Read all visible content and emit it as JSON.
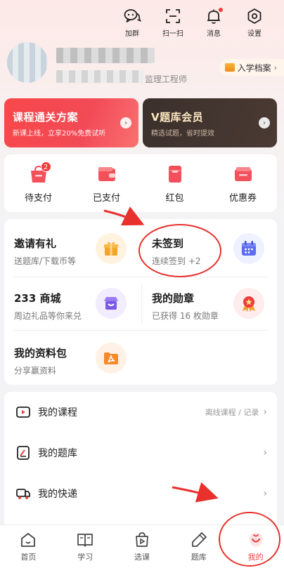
{
  "top_actions": [
    {
      "label": "加群",
      "icon": "wechat-group-icon"
    },
    {
      "label": "扫一扫",
      "icon": "scan-icon"
    },
    {
      "label": "消息",
      "icon": "bell-icon"
    },
    {
      "label": "设置",
      "icon": "gear-icon"
    }
  ],
  "profile": {
    "job_title": "监理工程师",
    "enroll_badge": "入学档案"
  },
  "promos": [
    {
      "title": "课程通关方案",
      "subtitle": "新课上线，立享20%免费试听"
    },
    {
      "title": "V题库会员",
      "subtitle": "精选试题，省时提效"
    }
  ],
  "orders": [
    {
      "label": "待支付",
      "badge": "2",
      "icon": "pending-payment-icon"
    },
    {
      "label": "已支付",
      "icon": "paid-wallet-icon"
    },
    {
      "label": "红包",
      "icon": "red-packet-icon"
    },
    {
      "label": "优惠券",
      "icon": "coupon-icon"
    }
  ],
  "features": [
    {
      "title": "邀请有礼",
      "subtitle": "送题库/下载币等",
      "icon": "gift-icon"
    },
    {
      "title": "未签到",
      "subtitle": "连续签到 +2",
      "icon": "calendar-icon"
    },
    {
      "title": "233 商城",
      "subtitle": "周边礼品等你来兑",
      "icon": "shop-icon"
    },
    {
      "title": "我的勋章",
      "subtitle": "已获得 16 枚勋章",
      "icon": "medal-icon"
    },
    {
      "title": "我的资料包",
      "subtitle": "分享赢资料",
      "icon": "folder-icon"
    }
  ],
  "menu": [
    {
      "label": "我的课程",
      "right": "离线课程 / 记录",
      "icon": "course-play-icon"
    },
    {
      "label": "我的题库",
      "right": "",
      "icon": "question-bank-icon"
    },
    {
      "label": "我的快递",
      "right": "",
      "icon": "delivery-truck-icon"
    }
  ],
  "bottom_nav": [
    {
      "label": "首页",
      "icon": "home-icon"
    },
    {
      "label": "学习",
      "icon": "book-icon"
    },
    {
      "label": "选课",
      "icon": "course-select-icon"
    },
    {
      "label": "题库",
      "icon": "pencil-icon"
    },
    {
      "label": "我的",
      "icon": "profile-smile-icon",
      "active": true
    }
  ],
  "colors": {
    "accent": "#e84545",
    "promo_red": "#f8484a",
    "promo_dark": "#3b302c",
    "annotation": "#e8302c"
  }
}
